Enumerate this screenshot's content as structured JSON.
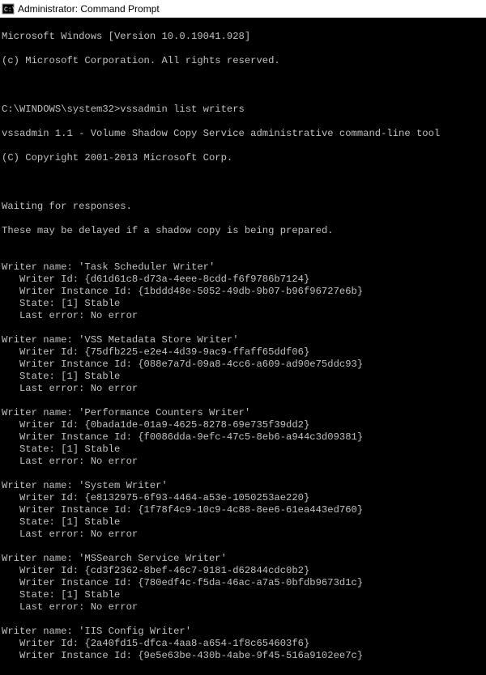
{
  "titlebar": {
    "title": "Administrator: Command Prompt"
  },
  "header": {
    "line1": "Microsoft Windows [Version 10.0.19041.928]",
    "line2": "(c) Microsoft Corporation. All rights reserved."
  },
  "prompt": {
    "path": "C:\\WINDOWS\\system32>",
    "cmd": "vssadmin list writers"
  },
  "banner": {
    "line1": "vssadmin 1.1 - Volume Shadow Copy Service administrative command-line tool",
    "line2": "(C) Copyright 2001-2013 Microsoft Corp."
  },
  "waiting": {
    "line1": "Waiting for responses.",
    "line2": "These may be delayed if a shadow copy is being prepared."
  },
  "labels": {
    "writer_name": "Writer name: ",
    "writer_id": "Writer Id: ",
    "writer_instance_id": "Writer Instance Id: ",
    "state": "State: ",
    "last_error": "Last error: "
  },
  "writers": [
    {
      "name": "'Task Scheduler Writer'",
      "id": "{d61d61c8-d73a-4eee-8cdd-f6f9786b7124}",
      "instance_id": "{1bddd48e-5052-49db-9b07-b96f96727e6b}",
      "state": "[1] Stable",
      "last_error": "No error"
    },
    {
      "name": "'VSS Metadata Store Writer'",
      "id": "{75dfb225-e2e4-4d39-9ac9-ffaff65ddf06}",
      "instance_id": "{088e7a7d-09a8-4cc6-a609-ad90e75ddc93}",
      "state": "[1] Stable",
      "last_error": "No error"
    },
    {
      "name": "'Performance Counters Writer'",
      "id": "{0bada1de-01a9-4625-8278-69e735f39dd2}",
      "instance_id": "{f0086dda-9efc-47c5-8eb6-a944c3d09381}",
      "state": "[1] Stable",
      "last_error": "No error"
    },
    {
      "name": "'System Writer'",
      "id": "{e8132975-6f93-4464-a53e-1050253ae220}",
      "instance_id": "{1f78f4c9-10c9-4c88-8ee6-61ea443ed760}",
      "state": "[1] Stable",
      "last_error": "No error"
    },
    {
      "name": "'MSSearch Service Writer'",
      "id": "{cd3f2362-8bef-46c7-9181-d62844cdc0b2}",
      "instance_id": "{780edf4c-f5da-46ac-a7a5-0bfdb9673d1c}",
      "state": "[1] Stable",
      "last_error": "No error"
    },
    {
      "name": "'IIS Config Writer'",
      "id": "{2a40fd15-dfca-4aa8-a654-1f8c654603f6}",
      "instance_id": "{9e5e63be-430b-4abe-9f45-516a9102ee7c}"
    }
  ]
}
